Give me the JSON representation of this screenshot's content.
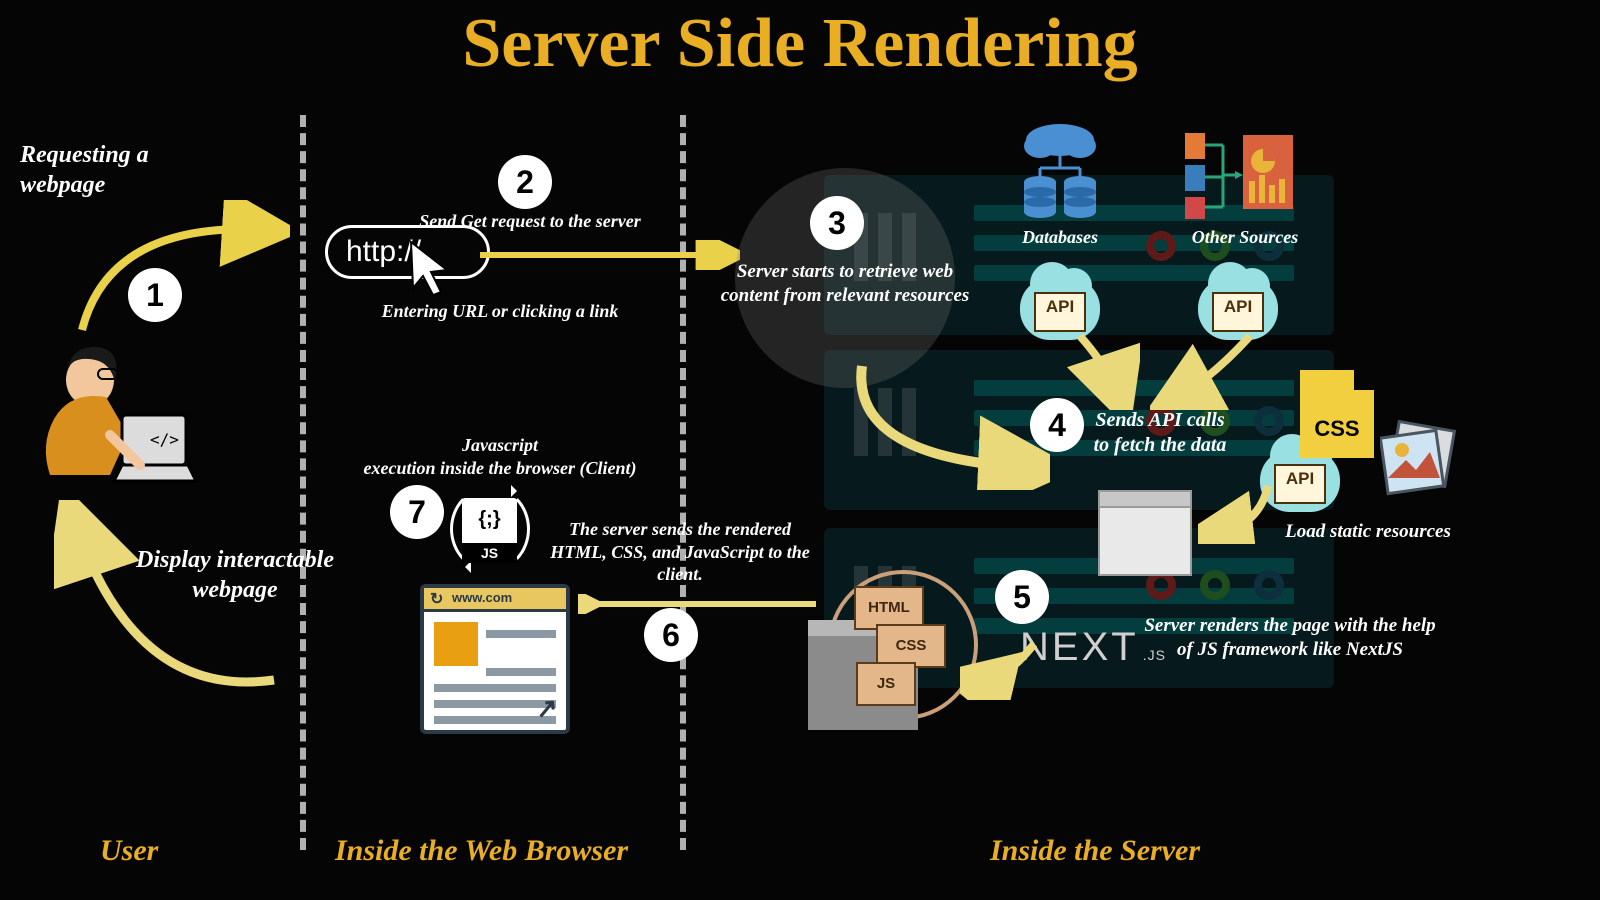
{
  "title": "Server Side Rendering",
  "columns": {
    "user": "User",
    "browser": "Inside the Web Browser",
    "server": "Inside the Server"
  },
  "steps": {
    "s1": {
      "num": "1",
      "label": "Requesting a webpage"
    },
    "s2": {
      "num": "2",
      "top": "Send Get request to the server",
      "bottom": "Entering URL or clicking a link",
      "url": "http://"
    },
    "s3": {
      "num": "3",
      "label": "Server  starts to retrieve web content from relevant resources"
    },
    "s4": {
      "num": "4",
      "label": "Sends API calls to fetch the data"
    },
    "s5": {
      "num": "5",
      "label": "Server renders the page with the help of  JS framework like NextJS"
    },
    "s6": {
      "num": "6",
      "label": "The server sends the rendered HTML, CSS, and JavaScript to the client."
    },
    "s7": {
      "num": "7",
      "label": "Javascript\nexecution inside the browser (Client)"
    },
    "s8": {
      "label": "Display interactable webpage"
    }
  },
  "server_labels": {
    "db": "Databases",
    "other": "Other Sources",
    "load_static": "Load static resources"
  },
  "tokens": {
    "api": "API",
    "css": "CSS",
    "js": "JS",
    "html": "HTML",
    "nextjs": "NEXT",
    "nextjs_suffix": ".JS",
    "browser_addr": "www.com"
  }
}
